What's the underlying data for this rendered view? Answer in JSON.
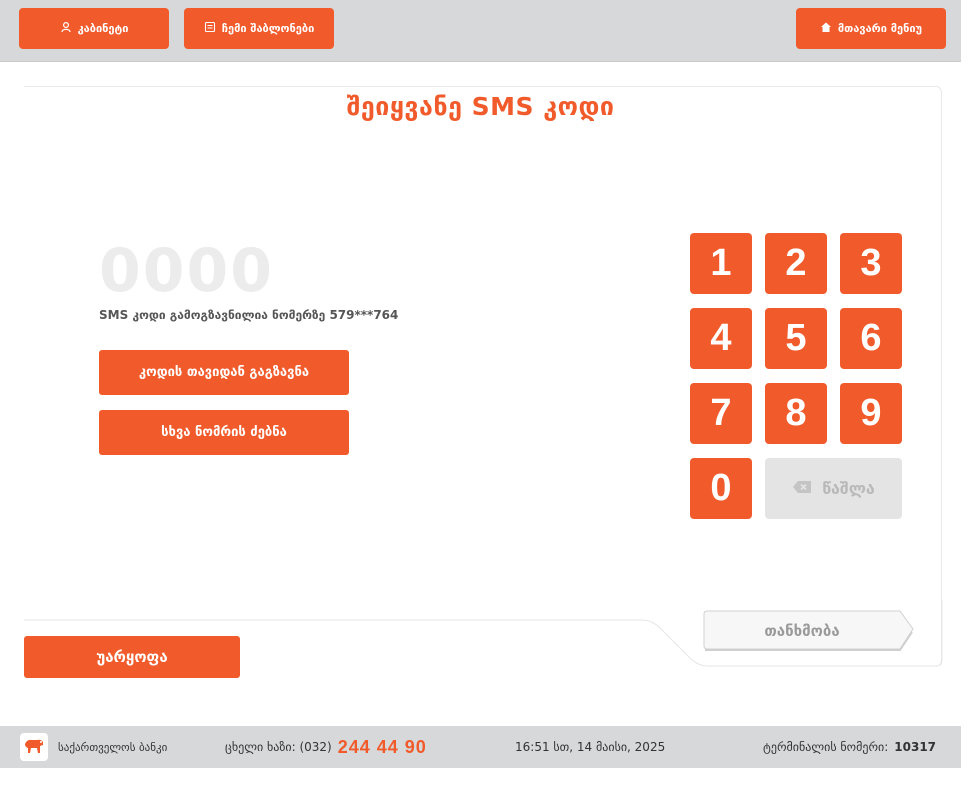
{
  "header": {
    "cabinet_label": "კაბინეტი",
    "templates_label": "ჩემი შაბლონები",
    "main_menu_label": "მთავარი მენიუ"
  },
  "page": {
    "title": "შეიყვანე SMS კოდი",
    "code_placeholder": "0000",
    "sms_note": "SMS კოდი გამოგზავნილია ნომერზე 579***764"
  },
  "actions": {
    "resend_label": "კოდის თავიდან გაგზავნა",
    "other_number_label": "სხვა ნომრის ძებნა"
  },
  "keypad": {
    "keys": [
      "1",
      "2",
      "3",
      "4",
      "5",
      "6",
      "7",
      "8",
      "9",
      "0"
    ],
    "delete_label": "წაშლა"
  },
  "footer_actions": {
    "agree_label": "თანხმობა",
    "reject_label": "უარყოფა"
  },
  "footer": {
    "bank_name": "საქართველოს ბანკი",
    "hotline_label": "ცხელი ხაზი: (032)",
    "hotline_number": "244 44 90",
    "datetime": "16:51 სთ, 14 მაისი, 2025",
    "terminal_label": "ტერმინალის ნომერი:",
    "terminal_number": "10317"
  },
  "colors": {
    "accent": "#f15a2b",
    "bar": "#d7d8da",
    "disabled": "#e4e4e4"
  }
}
